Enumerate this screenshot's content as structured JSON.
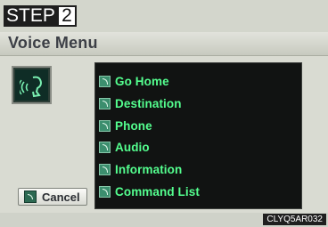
{
  "step": {
    "label": "STEP",
    "number": "2"
  },
  "title": "Voice Menu",
  "voice_icon": "voice-command-icon",
  "menu_items": [
    {
      "label": "Go Home",
      "icon": "voice-tag-icon"
    },
    {
      "label": "Destination",
      "icon": "voice-tag-icon"
    },
    {
      "label": "Phone",
      "icon": "voice-tag-icon"
    },
    {
      "label": "Audio",
      "icon": "voice-tag-icon"
    },
    {
      "label": "Information",
      "icon": "voice-tag-icon"
    },
    {
      "label": "Command List",
      "icon": "voice-tag-icon"
    }
  ],
  "cancel_button": {
    "label": "Cancel",
    "icon": "voice-tag-icon"
  },
  "image_code": "CLYQ5AR032",
  "colors": {
    "menu_text": "#54ff8f",
    "panel_bg": "#111312",
    "title_text": "#3c3f46",
    "icon_green": "#3c8e6e"
  }
}
